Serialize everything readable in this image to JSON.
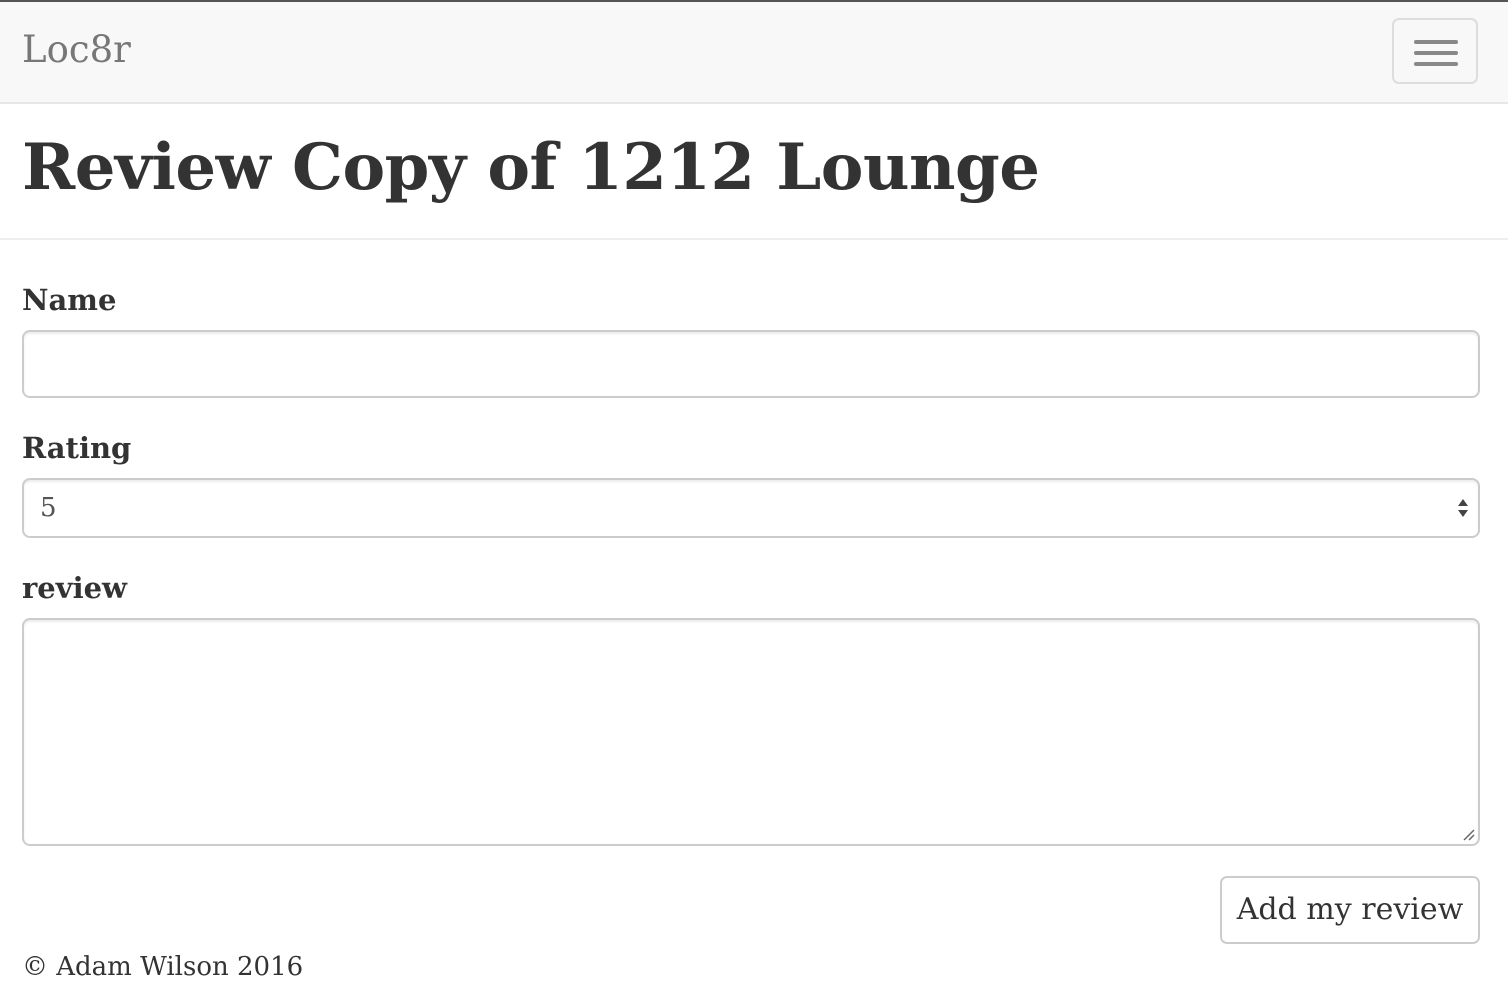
{
  "navbar": {
    "brand": "Loc8r",
    "menu_icon": "hamburger-menu-icon"
  },
  "page": {
    "title": "Review Copy of 1212 Lounge"
  },
  "form": {
    "name_label": "Name",
    "name_value": "",
    "rating_label": "Rating",
    "rating_value": "5",
    "review_label": "review",
    "review_value": "",
    "submit_label": "Add my review"
  },
  "footer": {
    "text": "© Adam Wilson 2016"
  }
}
